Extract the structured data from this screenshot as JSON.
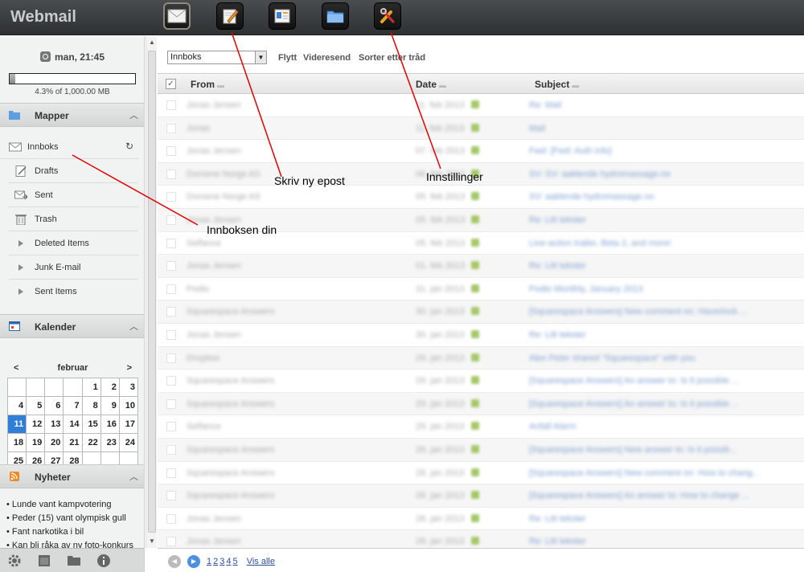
{
  "app": {
    "title": "Webmail"
  },
  "toolbar_buttons": [
    {
      "icon": "envelope-icon",
      "label": ""
    },
    {
      "icon": "compose-icon",
      "label": ""
    },
    {
      "icon": "contacts-icon",
      "label": ""
    },
    {
      "icon": "folder-icon",
      "label": ""
    },
    {
      "icon": "tools-icon",
      "label": ""
    }
  ],
  "sidebar": {
    "clock": "man, 21:45",
    "quota": {
      "text": "4.3% of 1,000.00 MB",
      "fraction": 0.043
    },
    "folders_title": "Mapper",
    "folders": [
      {
        "label": "Innboks",
        "icon": "envelope-icon"
      },
      {
        "label": "Drafts",
        "icon": "drafts-icon"
      },
      {
        "label": "Sent",
        "icon": "sent-icon"
      },
      {
        "label": "Trash",
        "icon": "trash-icon"
      },
      {
        "label": "Deleted Items",
        "icon": "triangle-icon"
      },
      {
        "label": "Junk E-mail",
        "icon": "triangle-icon"
      },
      {
        "label": "Sent Items",
        "icon": "triangle-icon"
      }
    ],
    "calendar_title": "Kalender",
    "calendar": {
      "month": "februar",
      "prev": "<",
      "next": ">",
      "today": "11",
      "weeks": [
        [
          "",
          "",
          "",
          "",
          "1",
          "2",
          "3"
        ],
        [
          "4",
          "5",
          "6",
          "7",
          "8",
          "9",
          "10"
        ],
        [
          "11",
          "12",
          "13",
          "14",
          "15",
          "16",
          "17"
        ],
        [
          "18",
          "19",
          "20",
          "21",
          "22",
          "23",
          "24"
        ],
        [
          "25",
          "26",
          "27",
          "28",
          "",
          "",
          ""
        ]
      ]
    },
    "news_title": "Nyheter",
    "news": [
      "Lunde vant kampvotering",
      "Peder (15) vant olympisk gull",
      "Fant narkotika i bil",
      "Kan bli råka av ny foto-konkurs"
    ]
  },
  "main": {
    "folder_select": "Innboks",
    "actions": [
      "Flytt",
      "Videresend",
      "Sorter etter tråd"
    ],
    "columns": {
      "from": "From",
      "date": "Date",
      "subject": "Subject"
    },
    "rows": [
      {
        "from": "Jonas Jensen",
        "date": "11. feb 2013",
        "subject": "Re: Mail"
      },
      {
        "from": "Jonas",
        "date": "11. feb 2013",
        "subject": "Mail"
      },
      {
        "from": "Jonas Jensen",
        "date": "07. feb 2013",
        "subject": "Fwd: [Fwd: Auth info]"
      },
      {
        "from": "Domene Norge AS",
        "date": "06. feb 2013",
        "subject": "SV: SV: aaklende hydromassage.no"
      },
      {
        "from": "Domene Norge AS",
        "date": "05. feb 2013",
        "subject": "SV: aaklende hydromassage.no"
      },
      {
        "from": "Jonas Jensen",
        "date": "05. feb 2013",
        "subject": "Re: Litt tekster"
      },
      {
        "from": "Selfance",
        "date": "05. feb 2013",
        "subject": "Live-action trailer, Beta 2, and more!"
      },
      {
        "from": "Jonas Jensen",
        "date": "01. feb 2013",
        "subject": "Re: Litt tekster"
      },
      {
        "from": "Podio",
        "date": "31. jan 2013",
        "subject": "Podio Monthly, January 2013"
      },
      {
        "from": "Squarespace Answers",
        "date": "30. jan 2013",
        "subject": "[Squarespace Answers] New comment on: Haverlock ..."
      },
      {
        "from": "Jonas Jensen",
        "date": "30. jan 2013",
        "subject": "Re: Litt tekster"
      },
      {
        "from": "Dropbox",
        "date": "29. jan 2013",
        "subject": "Alex Peter shared \"Squarespace\" with you"
      },
      {
        "from": "Squarespace Answers",
        "date": "29. jan 2013",
        "subject": "[Squarespace Answers] An answer to: Is it possible ..."
      },
      {
        "from": "Squarespace Answers",
        "date": "29. jan 2013",
        "subject": "[Squarespace Answers] An answer to: Is it possible ..."
      },
      {
        "from": "Selfance",
        "date": "29. jan 2013",
        "subject": "Anfall Alarm"
      },
      {
        "from": "Squarespace Answers",
        "date": "28. jan 2013",
        "subject": "[Squarespace Answers] New answer to: Is it possib..."
      },
      {
        "from": "Squarespace Answers",
        "date": "28. jan 2013",
        "subject": "[Squarespace Answers] New comment on: How to chang..."
      },
      {
        "from": "Squarespace Answers",
        "date": "28. jan 2013",
        "subject": "[Squarespace Answers] An answer to: How to change ..."
      },
      {
        "from": "Jonas Jensen",
        "date": "28. jan 2013",
        "subject": "Re: Litt tekster"
      },
      {
        "from": "Jonas Jensen",
        "date": "28. jan 2013",
        "subject": "Re: Litt tekster"
      }
    ],
    "pages": [
      "1",
      "2",
      "3",
      "4",
      "5"
    ],
    "show_all": "Vis alle"
  },
  "annotations": {
    "compose": "Skriv ny epost",
    "settings": "Innstillinger",
    "inbox": "Innboksen din"
  },
  "colors": {
    "topbar": "#3b3e41",
    "today": "#2f7fd6",
    "link": "#2d4f9c",
    "annotation_line": "#e00000"
  }
}
